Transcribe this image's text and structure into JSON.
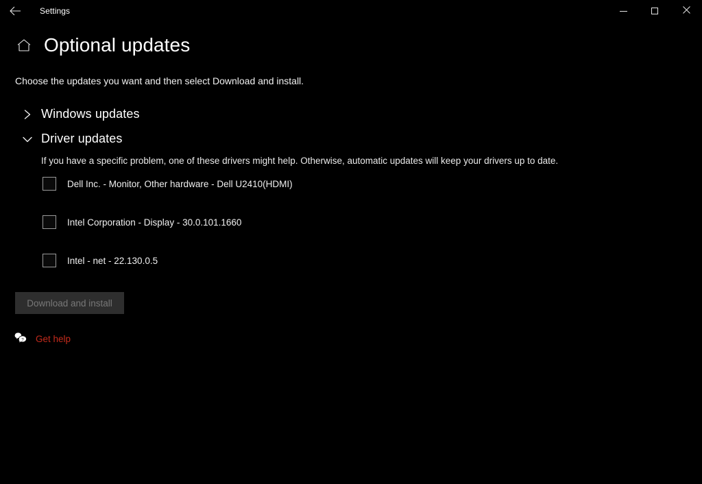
{
  "window": {
    "app_title": "Settings",
    "back_icon": "back-arrow-icon",
    "controls": {
      "minimize": "minimize-icon",
      "maximize": "maximize-icon",
      "close": "close-icon"
    }
  },
  "page": {
    "home_icon": "home-icon",
    "title": "Optional updates",
    "subtitle": "Choose the updates you want and then select Download and install."
  },
  "sections": [
    {
      "label": "Windows updates",
      "expanded": false,
      "chevron_icon": "chevron-right-icon"
    },
    {
      "label": "Driver updates",
      "expanded": true,
      "chevron_icon": "chevron-down-icon",
      "description": "If you have a specific problem, one of these drivers might help. Otherwise, automatic updates will keep your drivers up to date.",
      "updates": [
        {
          "label": "Dell Inc. - Monitor, Other hardware - Dell U2410(HDMI)",
          "checked": false
        },
        {
          "label": "Intel Corporation - Display - 30.0.101.1660",
          "checked": false
        },
        {
          "label": "Intel - net - 22.130.0.5",
          "checked": false
        }
      ]
    }
  ],
  "actions": {
    "download_install_label": "Download and install",
    "download_install_enabled": false
  },
  "help": {
    "icon": "help-bubble-icon",
    "label": "Get help"
  },
  "colors": {
    "background": "#000000",
    "text": "#ffffff",
    "accent_link": "#c42b1c",
    "button_disabled_bg": "#2e2e2e",
    "button_disabled_text": "#787878",
    "checkbox_border": "#9a9a9a"
  }
}
